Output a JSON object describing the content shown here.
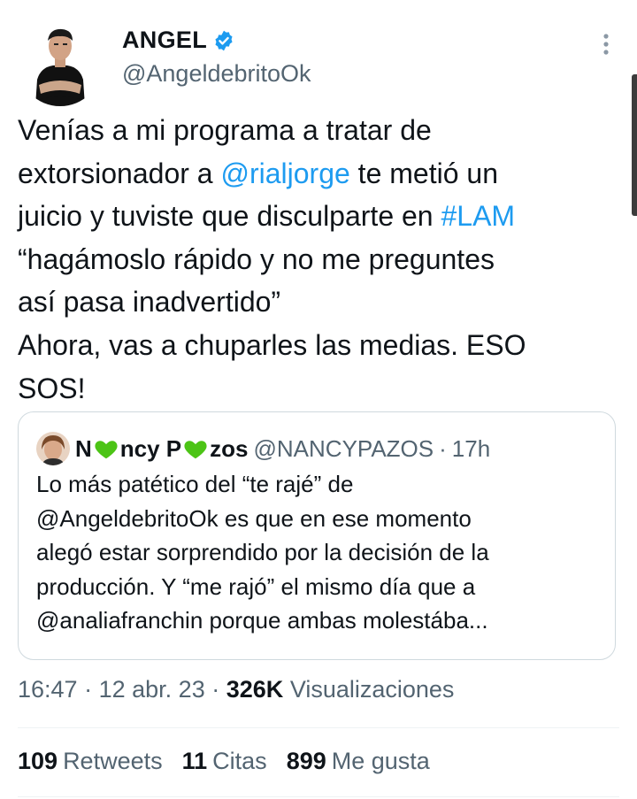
{
  "tweet": {
    "author": {
      "display_name": "ANGEL",
      "handle": "@AngeldebritoOk",
      "verified": true,
      "verified_icon": "verified-badge-icon",
      "verified_color": "#1d9bf0"
    },
    "more_icon": "more-vertical-icon",
    "text_lines": [
      [
        "Venías a mi programa a tratar de"
      ],
      [
        "extorsionador a ",
        {
          "link": "@rialjorge"
        },
        " te metió un"
      ],
      [
        "juicio y tuviste que disculparte en ",
        {
          "link": "#LAM"
        }
      ],
      [
        "“hagámoslo rápido y no me preguntes"
      ],
      [
        "así pasa inadvertido”"
      ],
      [
        "Ahora, vas a chuparles las medias. ESO"
      ],
      [
        "SOS!"
      ]
    ],
    "link_color": "#1d9bf0",
    "quoted": {
      "name_parts": [
        "N",
        "ncy P",
        "zos"
      ],
      "name_heart_icon": "green-heart-icon",
      "heart_color": "#4cc416",
      "handle": "@NANCYPAZOS",
      "separator": "·",
      "time": "17h",
      "text_lines": [
        "Lo más patético del “te rajé” de",
        "@AngeldebritoOk es que en ese momento",
        "alegó estar sorprendido por la decisión de la",
        "producción.  Y “me rajó” el mismo día que a",
        "@analiafranchin porque ambas molestába..."
      ]
    },
    "meta": {
      "time": "16:47",
      "sep1": "·",
      "date": "12 abr. 23",
      "sep2": "·",
      "views_count": "326K",
      "views_label": "Visualizaciones"
    },
    "stats": {
      "retweets_count": "109",
      "retweets_label": "Retweets",
      "quotes_count": "11",
      "quotes_label": "Citas",
      "likes_count": "899",
      "likes_label": "Me gusta"
    }
  }
}
